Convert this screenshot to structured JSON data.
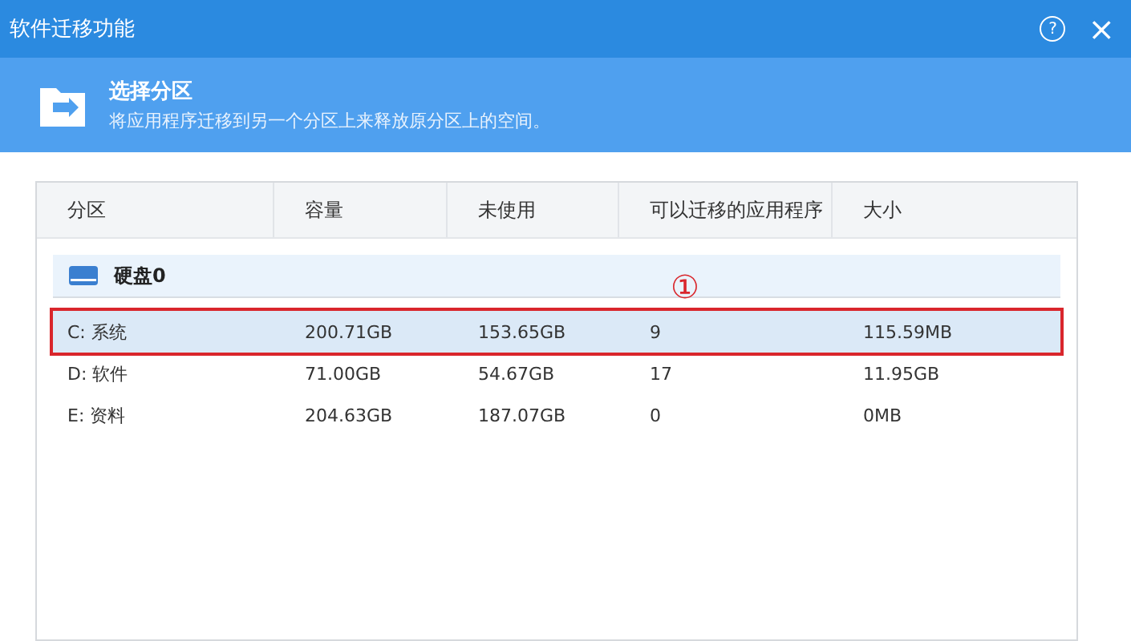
{
  "window": {
    "title": "软件迁移功能",
    "help": "?",
    "close": "×"
  },
  "header": {
    "title": "选择分区",
    "subtitle": "将应用程序迁移到另一个分区上来释放原分区上的空间。"
  },
  "table": {
    "columns": [
      "分区",
      "容量",
      "未使用",
      "可以迁移的应用程序",
      "大小"
    ],
    "disk": "硬盘0",
    "rows": [
      {
        "cells": [
          "C: 系统",
          "200.71GB",
          "153.65GB",
          "9",
          "115.59MB"
        ],
        "selected": true,
        "annotation": "①"
      },
      {
        "cells": [
          "D: 软件",
          "71.00GB",
          "54.67GB",
          "17",
          "11.95GB"
        ],
        "selected": false
      },
      {
        "cells": [
          "E: 资料",
          "204.63GB",
          "187.07GB",
          "0",
          "0MB"
        ],
        "selected": false
      }
    ]
  }
}
